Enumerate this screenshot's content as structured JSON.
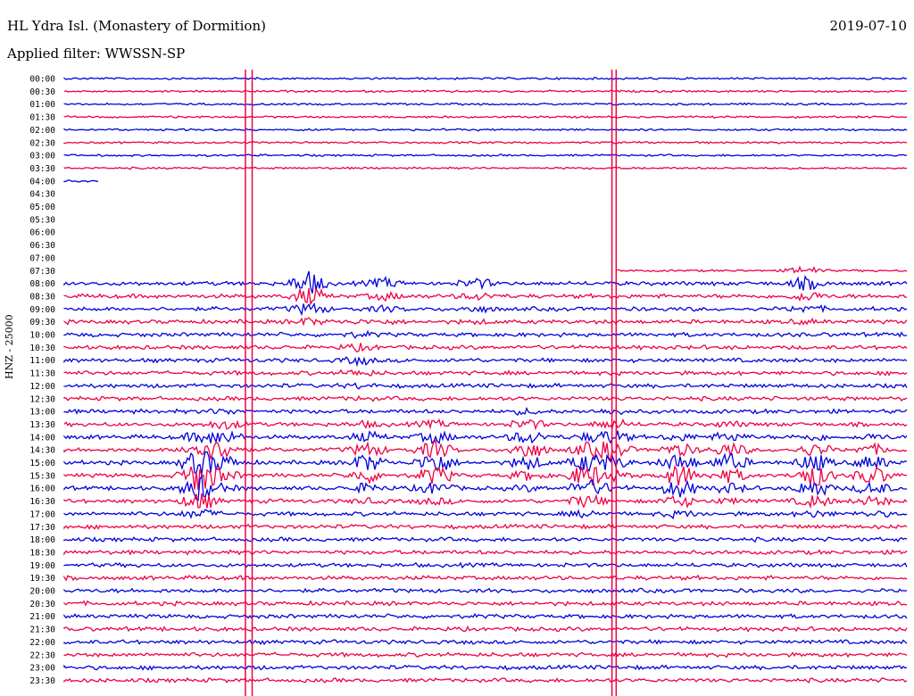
{
  "header": {
    "station": "HL Ydra Isl. (Monastery of Dormition)",
    "filter": "Applied filter: WWSSN-SP",
    "date": "2019-07-10"
  },
  "channel_label": "HNZ - 25000",
  "colors": {
    "trace_a": "#0000dd",
    "trace_b": "#ee0044",
    "background": "#ffffff"
  },
  "chart_data": {
    "type": "line",
    "title": "HL Ydra Isl. (Monastery of Dormition)",
    "date": "2019-07-10",
    "filter": "WWSSN-SP",
    "channel": "HNZ",
    "scale": 25000,
    "rows": [
      "00:00",
      "00:30",
      "01:00",
      "01:30",
      "02:00",
      "02:30",
      "03:00",
      "03:30",
      "04:00",
      "04:30",
      "05:00",
      "05:30",
      "06:00",
      "06:30",
      "07:00",
      "07:30",
      "08:00",
      "08:30",
      "09:00",
      "09:30",
      "10:00",
      "10:30",
      "11:00",
      "11:30",
      "12:00",
      "12:30",
      "13:00",
      "13:30",
      "14:00",
      "14:30",
      "15:00",
      "15:30",
      "16:00",
      "16:30",
      "17:00",
      "17:30",
      "18:00",
      "18:30",
      "19:00",
      "19:30",
      "20:00",
      "20:30",
      "21:00",
      "21:30",
      "22:00",
      "22:30",
      "23:00",
      "23:30"
    ],
    "row_minutes": 30,
    "data_gap": {
      "from": "04:00",
      "to": "07:30"
    },
    "grid": false,
    "legend": "none"
  }
}
